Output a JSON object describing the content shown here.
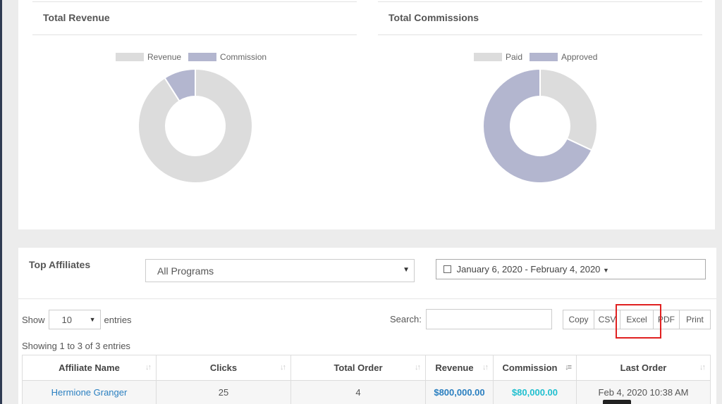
{
  "revenue_panel": {
    "title": "Total Revenue",
    "legend": [
      {
        "label": "Revenue",
        "color": "#dcdcdc"
      },
      {
        "label": "Commission",
        "color": "#b3b6cf"
      }
    ]
  },
  "commissions_panel": {
    "title": "Total Commissions",
    "legend": [
      {
        "label": "Paid",
        "color": "#dcdcdc"
      },
      {
        "label": "Approved",
        "color": "#b3b6cf"
      }
    ]
  },
  "chart_data": [
    {
      "type": "pie",
      "categories": [
        "Revenue",
        "Commission"
      ],
      "values": [
        91,
        9
      ],
      "colors": [
        "#dcdcdc",
        "#b3b6cf"
      ],
      "title": "Total Revenue",
      "legend": "top"
    },
    {
      "type": "pie",
      "categories": [
        "Paid",
        "Approved"
      ],
      "values": [
        32,
        68
      ],
      "colors": [
        "#dcdcdc",
        "#b3b6cf"
      ],
      "title": "Total Commissions",
      "legend": "top"
    }
  ],
  "top_affiliates": {
    "title": "Top Affiliates",
    "program_select": "All Programs",
    "date_range": "January 6, 2020 - February 4, 2020",
    "show_label": "Show",
    "page_length": "10",
    "entries_label": "entries",
    "search_label": "Search:",
    "search_value": "",
    "buttons": [
      "Copy",
      "CSV",
      "Excel",
      "PDF",
      "Print"
    ],
    "info": "Showing 1 to 3 of 3 entries",
    "columns": [
      "Affiliate Name",
      "Clicks",
      "Total Order",
      "Revenue",
      "Commission",
      "Last Order"
    ],
    "rows": [
      {
        "name": "Hermione Granger",
        "clicks": "25",
        "orders": "4",
        "revenue": "$800,000.00",
        "commission": "$80,000.00",
        "last_order": "Feb 4, 2020 10:38 AM"
      }
    ]
  },
  "icons": {
    "calendar": "calendar-icon",
    "sort": "sort-icon",
    "caret": "caret-down-icon"
  }
}
